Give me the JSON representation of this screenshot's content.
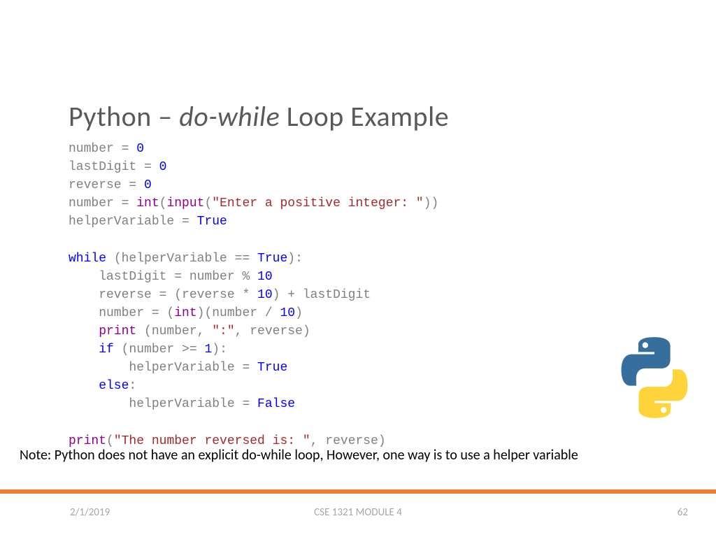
{
  "title": {
    "part1": "Python – ",
    "italic": "do-while",
    "part3": " Loop Example"
  },
  "code": {
    "l1": "number = ",
    "l1n": "0",
    "l2": "lastDigit = ",
    "l2n": "0",
    "l3": "reverse = ",
    "l3n": "0",
    "l4a": "number = ",
    "l4b": "int",
    "l4c": "(",
    "l4d": "input",
    "l4e": "(",
    "l4f": "\"Enter a positive integer: \"",
    "l4g": "))",
    "l5a": "helperVariable = ",
    "l5b": "True",
    "l7a": "while",
    "l7b": " (helperVariable == ",
    "l7c": "True",
    "l7d": "):",
    "l8": "    lastDigit = number % ",
    "l8n": "10",
    "l9a": "    reverse = (reverse * ",
    "l9b": "10",
    "l9c": ") + lastDigit",
    "l10a": "    number = (",
    "l10b": "int",
    "l10c": ")(number / ",
    "l10d": "10",
    "l10e": ")",
    "l11a": "    print ",
    "l11b": "(number, ",
    "l11c": "\":\"",
    "l11d": ", reverse)",
    "l12a": "    if ",
    "l12b": "(number >= ",
    "l12c": "1",
    "l12d": "):",
    "l13a": "        helperVariable = ",
    "l13b": "True",
    "l14a": "    else",
    "l14b": ":",
    "l15a": "        helperVariable = ",
    "l15b": "False",
    "l17a": "print",
    "l17b": "(",
    "l17c": "\"The number reversed is: \"",
    "l17d": ", reverse)"
  },
  "note": "Note: Python does not have an explicit do-while loop, However, one way is to use a helper variable",
  "footer": {
    "date": "2/1/2019",
    "center": "CSE 1321 MODULE 4",
    "page": "62"
  }
}
